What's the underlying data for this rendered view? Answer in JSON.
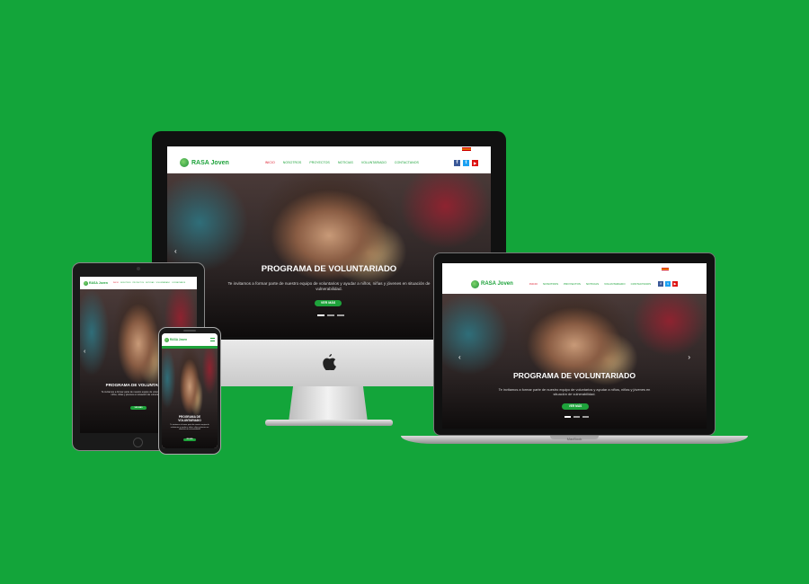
{
  "site": {
    "brand": "RASA Joven",
    "menu": [
      "INICIO",
      "NOSOTROS",
      "PROYECTOS",
      "NOTICIAS",
      "VOLUNTARIADO",
      "CONTACTANOS"
    ],
    "social": [
      "f",
      "t",
      "▶"
    ],
    "hero": {
      "title": "PROGRAMA DE VOLUNTARIADO",
      "text": "Te invitamos a formar parte de nuestro equipo de voluntarios y ayudar a niños, niñas y jóvenes en situación de vulnerabilidad.",
      "button": "VER MÁS"
    }
  },
  "devices": {
    "imac_logo": "",
    "macbook_label": "MacBook"
  },
  "colors": {
    "background": "#13a53a",
    "accent": "#1ea33b"
  }
}
